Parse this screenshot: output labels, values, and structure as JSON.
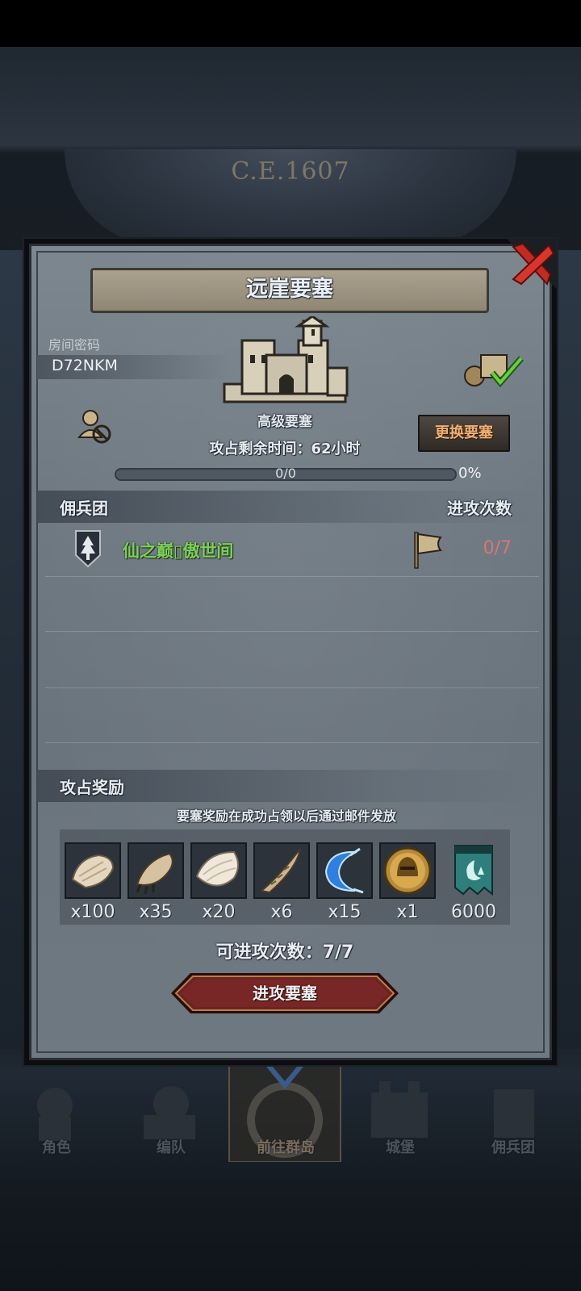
{
  "background": {
    "era_year": "C.E.1607"
  },
  "dialog": {
    "title": "远崖要塞",
    "room_code_label": "房间密码",
    "room_code": "D72NKM",
    "fortress_grade": "高级要塞",
    "time_remaining": "攻占剩余时间：62小时",
    "progress_text": "0/0",
    "progress_percent": "0%",
    "progress_fraction": 0,
    "swap_button": "更换要塞",
    "mercenary_header": "佣兵团",
    "attack_count_header": "进攻次数",
    "mercenary_rows": [
      {
        "name": "仙之巅▯傲世间",
        "attempts": "0/7"
      }
    ],
    "reward_header": "攻占奖励",
    "reward_note": "要塞奖励在成功占领以后通过邮件发放",
    "rewards": [
      {
        "icon": "fur-pelt-icon",
        "count": "x100"
      },
      {
        "icon": "beast-claw-icon",
        "count": "x35"
      },
      {
        "icon": "white-hide-icon",
        "count": "x20"
      },
      {
        "icon": "horn-icon",
        "count": "x6"
      },
      {
        "icon": "crescent-blade-icon",
        "count": "x15"
      },
      {
        "icon": "gold-helmet-medal-icon",
        "count": "x1"
      },
      {
        "icon": "guild-banner-icon",
        "count": "6000"
      }
    ],
    "attack_count": "可进攻次数：7/7",
    "attack_button": "进攻要塞"
  },
  "bottom_nav": [
    {
      "label": "角色"
    },
    {
      "label": "编队"
    },
    {
      "label": "前往群岛",
      "active": true
    },
    {
      "label": "城堡"
    },
    {
      "label": "佣兵团"
    }
  ],
  "colors": {
    "guild_name": "#7ccf5a",
    "attempts": "#d9776e",
    "swap_button_text": "#f0b070",
    "attack_button": "#6b2323"
  }
}
